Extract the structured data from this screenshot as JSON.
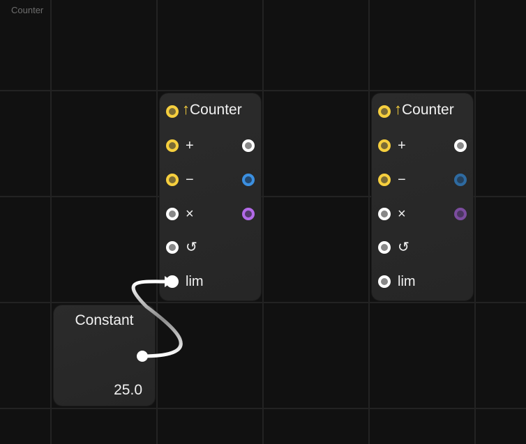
{
  "canvas": {
    "label": "Counter"
  },
  "nodes": {
    "counter1": {
      "title": "Counter",
      "title_icon": "↑",
      "rows": [
        {
          "label": "+",
          "in_color": "yellow",
          "out_color": "white"
        },
        {
          "label": "−",
          "in_color": "yellow",
          "out_color": "blue"
        },
        {
          "label": "×",
          "in_color": "white",
          "out_color": "purple"
        },
        {
          "label": "↺",
          "in_color": "white"
        },
        {
          "label": "lim",
          "in_color": "white",
          "connected": true
        }
      ]
    },
    "counter2": {
      "title": "Counter",
      "title_icon": "↑",
      "rows": [
        {
          "label": "+",
          "in_color": "yellow",
          "out_color": "white"
        },
        {
          "label": "−",
          "in_color": "yellow",
          "out_color": "blue-dim"
        },
        {
          "label": "×",
          "in_color": "white",
          "out_color": "purple-dim"
        },
        {
          "label": "↺",
          "in_color": "white"
        },
        {
          "label": "lim",
          "in_color": "white"
        }
      ]
    },
    "constant": {
      "title": "Constant",
      "value": "25.0"
    }
  },
  "connections": [
    {
      "from": "constant.out",
      "to": "counter1.lim"
    }
  ],
  "colors": {
    "background": "#111111",
    "grid": "#232323",
    "node": "#2a2a2a",
    "yellow": "#f6cf3e",
    "blue": "#3b8fe0",
    "purple": "#b36ae8",
    "wire": "#ffffff"
  }
}
